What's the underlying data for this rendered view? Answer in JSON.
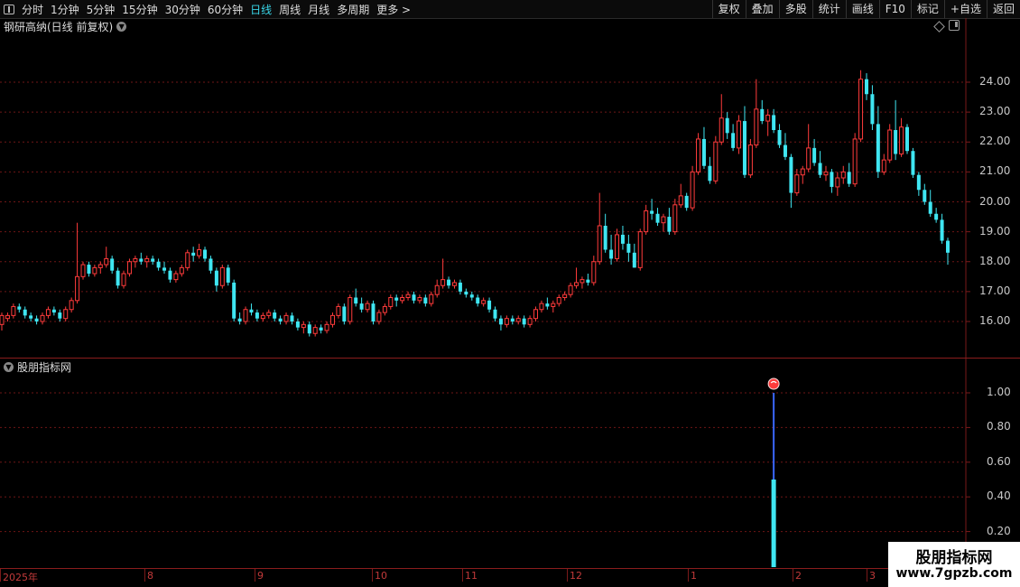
{
  "toolbar": {
    "periods": [
      "分时",
      "1分钟",
      "5分钟",
      "15分钟",
      "30分钟",
      "60分钟",
      "日线",
      "周线",
      "月线",
      "多周期",
      "更多 >"
    ],
    "active_period": "日线",
    "right_buttons": [
      "复权",
      "叠加",
      "多股",
      "统计",
      "画线",
      "F10",
      "标记",
      "+自选",
      "返回"
    ]
  },
  "main": {
    "title": "钢研高纳(日线 前复权)",
    "price_ticks": [
      "24.00",
      "23.00",
      "22.00",
      "21.00",
      "20.00",
      "19.00",
      "18.00",
      "17.00",
      "16.00"
    ]
  },
  "sub": {
    "title": "股朋指标网",
    "ticks": [
      "1.00",
      "0.80",
      "0.60",
      "0.40",
      "0.20"
    ]
  },
  "date_axis": [
    "2025年",
    "8",
    "9",
    "10",
    "11",
    "12",
    "1",
    "2",
    "3"
  ],
  "watermark": {
    "line1": "股朋指标网",
    "line2": "www.7gpzb.com"
  },
  "colors": {
    "up": "#ff3b3b",
    "down": "#3fe6f2",
    "grid": "#6e1616",
    "axis_text": "#c23a3a"
  },
  "chart_data": {
    "type": "candlestick",
    "title": "钢研高纳(日线 前复权)",
    "ylim": [
      15.2,
      25.0
    ],
    "candles": [
      {
        "o": 15.9,
        "h": 16.3,
        "l": 15.7,
        "c": 16.2
      },
      {
        "o": 16.1,
        "h": 16.3,
        "l": 16.0,
        "c": 16.2
      },
      {
        "o": 16.2,
        "h": 16.6,
        "l": 16.1,
        "c": 16.5
      },
      {
        "o": 16.5,
        "h": 16.6,
        "l": 16.3,
        "c": 16.4
      },
      {
        "o": 16.4,
        "h": 16.5,
        "l": 16.1,
        "c": 16.2
      },
      {
        "o": 16.2,
        "h": 16.3,
        "l": 16.0,
        "c": 16.1
      },
      {
        "o": 16.1,
        "h": 16.2,
        "l": 15.9,
        "c": 16.0
      },
      {
        "o": 16.0,
        "h": 16.3,
        "l": 15.9,
        "c": 16.2
      },
      {
        "o": 16.2,
        "h": 16.5,
        "l": 16.1,
        "c": 16.4
      },
      {
        "o": 16.4,
        "h": 16.5,
        "l": 16.2,
        "c": 16.3
      },
      {
        "o": 16.3,
        "h": 16.4,
        "l": 16.0,
        "c": 16.1
      },
      {
        "o": 16.1,
        "h": 16.5,
        "l": 16.0,
        "c": 16.4
      },
      {
        "o": 16.4,
        "h": 16.8,
        "l": 16.3,
        "c": 16.7
      },
      {
        "o": 16.7,
        "h": 19.3,
        "l": 16.6,
        "c": 17.5
      },
      {
        "o": 17.5,
        "h": 18.0,
        "l": 17.4,
        "c": 17.9
      },
      {
        "o": 17.9,
        "h": 18.0,
        "l": 17.5,
        "c": 17.6
      },
      {
        "o": 17.6,
        "h": 17.9,
        "l": 17.5,
        "c": 17.8
      },
      {
        "o": 17.8,
        "h": 18.0,
        "l": 17.6,
        "c": 17.9
      },
      {
        "o": 17.9,
        "h": 18.5,
        "l": 17.8,
        "c": 18.1
      },
      {
        "o": 18.1,
        "h": 18.2,
        "l": 17.6,
        "c": 17.7
      },
      {
        "o": 17.7,
        "h": 17.8,
        "l": 17.1,
        "c": 17.2
      },
      {
        "o": 17.2,
        "h": 17.7,
        "l": 17.1,
        "c": 17.6
      },
      {
        "o": 17.6,
        "h": 18.1,
        "l": 17.5,
        "c": 18.0
      },
      {
        "o": 18.0,
        "h": 18.2,
        "l": 17.8,
        "c": 18.1
      },
      {
        "o": 18.1,
        "h": 18.3,
        "l": 17.9,
        "c": 18.0
      },
      {
        "o": 18.0,
        "h": 18.2,
        "l": 17.8,
        "c": 18.1
      },
      {
        "o": 18.1,
        "h": 18.2,
        "l": 17.9,
        "c": 18.0
      },
      {
        "o": 18.0,
        "h": 18.1,
        "l": 17.7,
        "c": 17.8
      },
      {
        "o": 17.8,
        "h": 18.0,
        "l": 17.6,
        "c": 17.7
      },
      {
        "o": 17.7,
        "h": 17.8,
        "l": 17.3,
        "c": 17.4
      },
      {
        "o": 17.4,
        "h": 17.7,
        "l": 17.3,
        "c": 17.6
      },
      {
        "o": 17.6,
        "h": 17.9,
        "l": 17.5,
        "c": 17.8
      },
      {
        "o": 17.8,
        "h": 18.4,
        "l": 17.7,
        "c": 18.3
      },
      {
        "o": 18.3,
        "h": 18.5,
        "l": 18.0,
        "c": 18.2
      },
      {
        "o": 18.2,
        "h": 18.6,
        "l": 18.1,
        "c": 18.4
      },
      {
        "o": 18.4,
        "h": 18.5,
        "l": 18.0,
        "c": 18.1
      },
      {
        "o": 18.1,
        "h": 18.2,
        "l": 17.6,
        "c": 17.7
      },
      {
        "o": 17.7,
        "h": 17.8,
        "l": 17.0,
        "c": 17.2
      },
      {
        "o": 17.2,
        "h": 17.9,
        "l": 17.1,
        "c": 17.8
      },
      {
        "o": 17.8,
        "h": 17.9,
        "l": 17.2,
        "c": 17.3
      },
      {
        "o": 17.3,
        "h": 17.4,
        "l": 16.0,
        "c": 16.1
      },
      {
        "o": 16.1,
        "h": 16.3,
        "l": 15.9,
        "c": 16.0
      },
      {
        "o": 16.0,
        "h": 16.5,
        "l": 15.9,
        "c": 16.4
      },
      {
        "o": 16.4,
        "h": 16.6,
        "l": 16.2,
        "c": 16.3
      },
      {
        "o": 16.3,
        "h": 16.4,
        "l": 16.0,
        "c": 16.1
      },
      {
        "o": 16.1,
        "h": 16.3,
        "l": 16.0,
        "c": 16.2
      },
      {
        "o": 16.2,
        "h": 16.4,
        "l": 16.1,
        "c": 16.3
      },
      {
        "o": 16.3,
        "h": 16.4,
        "l": 16.0,
        "c": 16.1
      },
      {
        "o": 16.1,
        "h": 16.2,
        "l": 15.9,
        "c": 16.0
      },
      {
        "o": 16.0,
        "h": 16.3,
        "l": 15.9,
        "c": 16.2
      },
      {
        "o": 16.2,
        "h": 16.3,
        "l": 15.9,
        "c": 16.0
      },
      {
        "o": 16.0,
        "h": 16.1,
        "l": 15.7,
        "c": 15.8
      },
      {
        "o": 15.8,
        "h": 16.0,
        "l": 15.6,
        "c": 15.9
      },
      {
        "o": 15.9,
        "h": 16.0,
        "l": 15.5,
        "c": 15.6
      },
      {
        "o": 15.6,
        "h": 15.9,
        "l": 15.5,
        "c": 15.8
      },
      {
        "o": 15.8,
        "h": 15.9,
        "l": 15.6,
        "c": 15.7
      },
      {
        "o": 15.7,
        "h": 16.0,
        "l": 15.6,
        "c": 15.9
      },
      {
        "o": 15.9,
        "h": 16.3,
        "l": 15.8,
        "c": 16.2
      },
      {
        "o": 16.2,
        "h": 16.6,
        "l": 16.1,
        "c": 16.5
      },
      {
        "o": 16.5,
        "h": 16.6,
        "l": 15.9,
        "c": 16.0
      },
      {
        "o": 16.0,
        "h": 16.9,
        "l": 15.9,
        "c": 16.8
      },
      {
        "o": 16.8,
        "h": 17.1,
        "l": 16.5,
        "c": 16.6
      },
      {
        "o": 16.6,
        "h": 16.8,
        "l": 16.3,
        "c": 16.4
      },
      {
        "o": 16.4,
        "h": 16.7,
        "l": 16.3,
        "c": 16.6
      },
      {
        "o": 16.6,
        "h": 16.7,
        "l": 15.9,
        "c": 16.0
      },
      {
        "o": 16.0,
        "h": 16.4,
        "l": 15.9,
        "c": 16.3
      },
      {
        "o": 16.3,
        "h": 16.6,
        "l": 16.2,
        "c": 16.5
      },
      {
        "o": 16.5,
        "h": 16.9,
        "l": 16.4,
        "c": 16.8
      },
      {
        "o": 16.8,
        "h": 16.9,
        "l": 16.5,
        "c": 16.7
      },
      {
        "o": 16.7,
        "h": 16.9,
        "l": 16.6,
        "c": 16.8
      },
      {
        "o": 16.8,
        "h": 17.0,
        "l": 16.7,
        "c": 16.9
      },
      {
        "o": 16.9,
        "h": 17.0,
        "l": 16.6,
        "c": 16.7
      },
      {
        "o": 16.7,
        "h": 16.9,
        "l": 16.6,
        "c": 16.8
      },
      {
        "o": 16.8,
        "h": 16.9,
        "l": 16.5,
        "c": 16.6
      },
      {
        "o": 16.6,
        "h": 17.0,
        "l": 16.5,
        "c": 16.9
      },
      {
        "o": 16.9,
        "h": 17.4,
        "l": 16.8,
        "c": 17.2
      },
      {
        "o": 17.2,
        "h": 18.1,
        "l": 17.1,
        "c": 17.4
      },
      {
        "o": 17.4,
        "h": 17.5,
        "l": 17.1,
        "c": 17.2
      },
      {
        "o": 17.2,
        "h": 17.4,
        "l": 17.1,
        "c": 17.3
      },
      {
        "o": 17.3,
        "h": 17.4,
        "l": 16.9,
        "c": 17.0
      },
      {
        "o": 17.0,
        "h": 17.1,
        "l": 16.8,
        "c": 16.9
      },
      {
        "o": 16.9,
        "h": 17.0,
        "l": 16.7,
        "c": 16.8
      },
      {
        "o": 16.8,
        "h": 16.9,
        "l": 16.5,
        "c": 16.6
      },
      {
        "o": 16.6,
        "h": 16.8,
        "l": 16.5,
        "c": 16.7
      },
      {
        "o": 16.7,
        "h": 16.8,
        "l": 16.3,
        "c": 16.4
      },
      {
        "o": 16.4,
        "h": 16.5,
        "l": 16.0,
        "c": 16.1
      },
      {
        "o": 16.1,
        "h": 16.2,
        "l": 15.7,
        "c": 15.9
      },
      {
        "o": 15.9,
        "h": 16.2,
        "l": 15.8,
        "c": 16.1
      },
      {
        "o": 16.1,
        "h": 16.2,
        "l": 15.9,
        "c": 16.0
      },
      {
        "o": 16.0,
        "h": 16.2,
        "l": 15.9,
        "c": 16.1
      },
      {
        "o": 16.1,
        "h": 16.2,
        "l": 15.8,
        "c": 15.9
      },
      {
        "o": 15.9,
        "h": 16.2,
        "l": 15.8,
        "c": 16.1
      },
      {
        "o": 16.1,
        "h": 16.5,
        "l": 16.0,
        "c": 16.4
      },
      {
        "o": 16.4,
        "h": 16.7,
        "l": 16.3,
        "c": 16.6
      },
      {
        "o": 16.6,
        "h": 16.8,
        "l": 16.4,
        "c": 16.5
      },
      {
        "o": 16.5,
        "h": 16.7,
        "l": 16.3,
        "c": 16.6
      },
      {
        "o": 16.6,
        "h": 16.9,
        "l": 16.5,
        "c": 16.8
      },
      {
        "o": 16.8,
        "h": 17.0,
        "l": 16.7,
        "c": 16.9
      },
      {
        "o": 16.9,
        "h": 17.3,
        "l": 16.8,
        "c": 17.2
      },
      {
        "o": 17.2,
        "h": 17.8,
        "l": 17.1,
        "c": 17.3
      },
      {
        "o": 17.3,
        "h": 17.5,
        "l": 17.1,
        "c": 17.4
      },
      {
        "o": 17.4,
        "h": 17.6,
        "l": 17.2,
        "c": 17.3
      },
      {
        "o": 17.3,
        "h": 18.2,
        "l": 17.2,
        "c": 18.0
      },
      {
        "o": 18.0,
        "h": 20.3,
        "l": 17.9,
        "c": 19.2
      },
      {
        "o": 19.2,
        "h": 19.6,
        "l": 18.3,
        "c": 18.4
      },
      {
        "o": 18.4,
        "h": 18.9,
        "l": 17.9,
        "c": 18.1
      },
      {
        "o": 18.1,
        "h": 19.1,
        "l": 18.0,
        "c": 18.9
      },
      {
        "o": 18.9,
        "h": 19.2,
        "l": 18.4,
        "c": 18.6
      },
      {
        "o": 18.6,
        "h": 18.9,
        "l": 18.0,
        "c": 18.3
      },
      {
        "o": 18.3,
        "h": 18.6,
        "l": 17.8,
        "c": 17.8
      },
      {
        "o": 17.8,
        "h": 19.1,
        "l": 17.7,
        "c": 19.0
      },
      {
        "o": 19.0,
        "h": 19.9,
        "l": 18.9,
        "c": 19.7
      },
      {
        "o": 19.7,
        "h": 20.1,
        "l": 19.4,
        "c": 19.6
      },
      {
        "o": 19.6,
        "h": 19.8,
        "l": 19.2,
        "c": 19.3
      },
      {
        "o": 19.3,
        "h": 19.6,
        "l": 19.0,
        "c": 19.5
      },
      {
        "o": 19.5,
        "h": 19.8,
        "l": 18.9,
        "c": 19.0
      },
      {
        "o": 19.0,
        "h": 20.1,
        "l": 18.9,
        "c": 19.9
      },
      {
        "o": 19.9,
        "h": 20.6,
        "l": 19.8,
        "c": 20.2
      },
      {
        "o": 20.2,
        "h": 20.3,
        "l": 19.7,
        "c": 19.8
      },
      {
        "o": 19.8,
        "h": 21.2,
        "l": 19.7,
        "c": 21.0
      },
      {
        "o": 21.0,
        "h": 22.3,
        "l": 20.9,
        "c": 22.1
      },
      {
        "o": 22.1,
        "h": 22.5,
        "l": 21.1,
        "c": 21.2
      },
      {
        "o": 21.2,
        "h": 21.5,
        "l": 20.6,
        "c": 20.7
      },
      {
        "o": 20.7,
        "h": 22.2,
        "l": 20.6,
        "c": 22.0
      },
      {
        "o": 22.0,
        "h": 23.6,
        "l": 21.9,
        "c": 22.8
      },
      {
        "o": 22.8,
        "h": 23.0,
        "l": 22.1,
        "c": 22.3
      },
      {
        "o": 22.3,
        "h": 22.6,
        "l": 21.7,
        "c": 21.8
      },
      {
        "o": 21.8,
        "h": 22.9,
        "l": 21.6,
        "c": 22.7
      },
      {
        "o": 22.7,
        "h": 23.2,
        "l": 20.8,
        "c": 20.9
      },
      {
        "o": 20.9,
        "h": 22.1,
        "l": 20.8,
        "c": 21.9
      },
      {
        "o": 21.9,
        "h": 24.1,
        "l": 21.8,
        "c": 23.1
      },
      {
        "o": 23.1,
        "h": 23.4,
        "l": 22.6,
        "c": 22.7
      },
      {
        "o": 22.7,
        "h": 23.1,
        "l": 22.2,
        "c": 22.9
      },
      {
        "o": 22.9,
        "h": 23.1,
        "l": 22.3,
        "c": 22.4
      },
      {
        "o": 22.4,
        "h": 22.6,
        "l": 21.8,
        "c": 21.9
      },
      {
        "o": 21.9,
        "h": 22.3,
        "l": 21.4,
        "c": 21.5
      },
      {
        "o": 21.5,
        "h": 21.6,
        "l": 19.8,
        "c": 20.3
      },
      {
        "o": 20.3,
        "h": 21.1,
        "l": 20.2,
        "c": 20.9
      },
      {
        "o": 20.9,
        "h": 21.2,
        "l": 20.6,
        "c": 21.1
      },
      {
        "o": 21.1,
        "h": 22.6,
        "l": 21.0,
        "c": 21.8
      },
      {
        "o": 21.8,
        "h": 22.1,
        "l": 21.2,
        "c": 21.3
      },
      {
        "o": 21.3,
        "h": 21.7,
        "l": 20.8,
        "c": 20.9
      },
      {
        "o": 20.9,
        "h": 21.2,
        "l": 20.7,
        "c": 21.0
      },
      {
        "o": 21.0,
        "h": 21.1,
        "l": 20.3,
        "c": 20.5
      },
      {
        "o": 20.5,
        "h": 21.0,
        "l": 20.2,
        "c": 20.8
      },
      {
        "o": 20.8,
        "h": 21.2,
        "l": 20.6,
        "c": 21.0
      },
      {
        "o": 21.0,
        "h": 21.3,
        "l": 20.5,
        "c": 20.6
      },
      {
        "o": 20.6,
        "h": 22.3,
        "l": 20.5,
        "c": 22.1
      },
      {
        "o": 22.1,
        "h": 24.4,
        "l": 22.0,
        "c": 24.1
      },
      {
        "o": 24.1,
        "h": 24.3,
        "l": 23.4,
        "c": 23.6
      },
      {
        "o": 23.6,
        "h": 23.9,
        "l": 22.4,
        "c": 22.6
      },
      {
        "o": 22.6,
        "h": 23.2,
        "l": 20.8,
        "c": 21.0
      },
      {
        "o": 21.0,
        "h": 21.6,
        "l": 20.9,
        "c": 21.4
      },
      {
        "o": 21.4,
        "h": 22.6,
        "l": 21.3,
        "c": 22.4
      },
      {
        "o": 22.4,
        "h": 23.4,
        "l": 21.4,
        "c": 21.6
      },
      {
        "o": 21.6,
        "h": 22.8,
        "l": 21.5,
        "c": 22.5
      },
      {
        "o": 22.5,
        "h": 22.6,
        "l": 21.6,
        "c": 21.7
      },
      {
        "o": 21.7,
        "h": 21.8,
        "l": 20.8,
        "c": 20.9
      },
      {
        "o": 20.9,
        "h": 21.0,
        "l": 20.2,
        "c": 20.4
      },
      {
        "o": 20.4,
        "h": 20.6,
        "l": 19.9,
        "c": 20.0
      },
      {
        "o": 20.0,
        "h": 20.4,
        "l": 19.5,
        "c": 19.6
      },
      {
        "o": 19.6,
        "h": 19.8,
        "l": 19.3,
        "c": 19.4
      },
      {
        "o": 19.4,
        "h": 19.6,
        "l": 18.6,
        "c": 18.7
      },
      {
        "o": 18.7,
        "h": 18.8,
        "l": 17.9,
        "c": 18.3
      }
    ],
    "indicator": {
      "name": "股朋指标网",
      "ylim": [
        0,
        1.1
      ],
      "signal_index": 133,
      "signal_value": 1.0,
      "bar_value": 0.5
    },
    "date_labels": [
      "2025年",
      "8",
      "9",
      "10",
      "11",
      "12",
      "1",
      "2",
      "3"
    ]
  }
}
